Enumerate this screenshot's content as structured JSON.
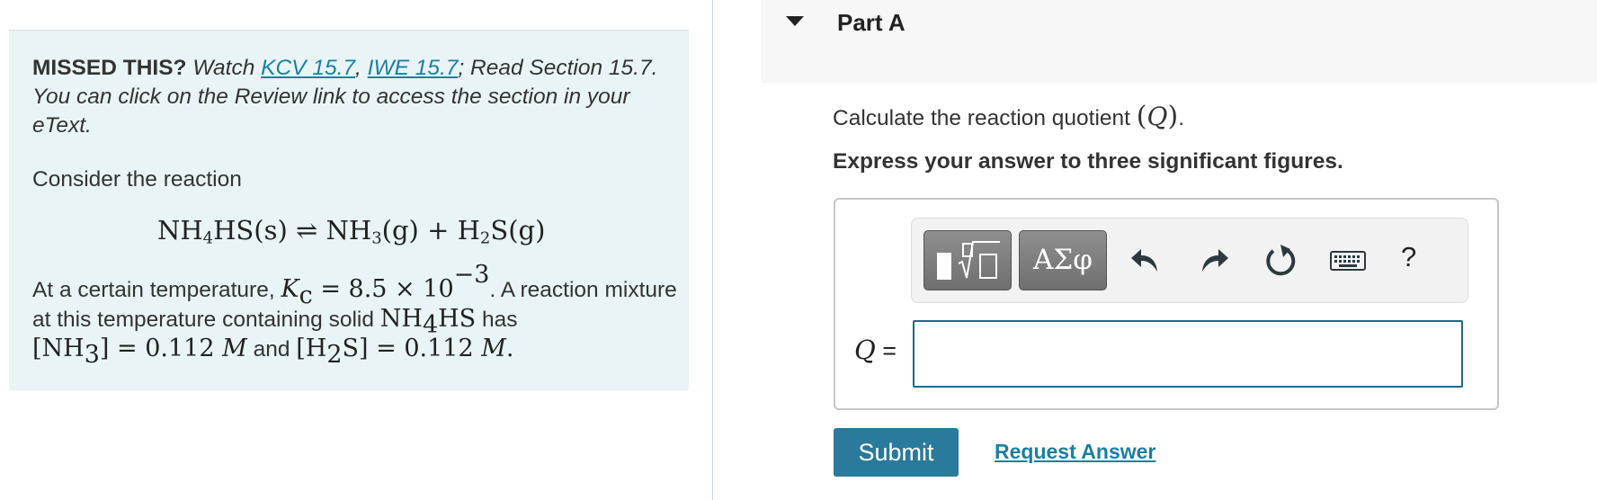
{
  "left_panel": {
    "missed_bold": "MISSED THIS?",
    "missed_watch": "Watch",
    "link_kcv": "KCV 15.7",
    "link_sep": ",",
    "link_iwe": "IWE 15.7",
    "missed_rest": "; Read Section 15.7. You can click on the Review link to access the section in your eText.",
    "consider": "Consider the reaction",
    "eq": {
      "r1_a": "NH",
      "r1_sub": "4",
      "r1_b": "HS(s)",
      "arrow": "⇌",
      "p1_a": "NH",
      "p1_sub": "3",
      "p1_b": "(g)",
      "plus": "+",
      "p2_a": "H",
      "p2_sub": "2",
      "p2_b": "S(g)"
    },
    "para": {
      "t1": "At a certain temperature, ",
      "kc": "K",
      "kc_sub": "c",
      "kc_val": " = 8.5 × 10",
      "kc_exp": "−3",
      "t2": ". A reaction mixture at this temperature containing solid ",
      "nh4hs_a": "NH",
      "nh4hs_sub": "4",
      "nh4hs_b": "HS",
      "t3": " has ",
      "c1_a": "[NH",
      "c1_sub": "3",
      "c1_b": "] = 0.112 ",
      "unit": "M",
      "t4": " and ",
      "c2_a": "[H",
      "c2_sub": "2",
      "c2_b": "S] = 0.112 ",
      "t5": "."
    }
  },
  "part": {
    "title": "Part A"
  },
  "question": {
    "prompt_text": "Calculate the reaction quotient ",
    "prompt_open": "(",
    "prompt_var": "Q",
    "prompt_close": ")",
    "prompt_end": ".",
    "instruction": "Express your answer to three significant figures."
  },
  "toolbar": {
    "greek_label": "ΑΣφ",
    "help_label": "?"
  },
  "answer": {
    "var": "Q",
    "eq": " =",
    "value": "",
    "placeholder": ""
  },
  "buttons": {
    "submit": "Submit",
    "request": "Request Answer"
  },
  "colors": {
    "info_bg": "#e8f4f6",
    "link": "#1a7fa3",
    "submit_bg": "#2a7a9b",
    "input_border": "#1a6a8c"
  },
  "icons": [
    "caret-down-icon",
    "templates-icon",
    "undo-icon",
    "redo-icon",
    "reset-icon",
    "keyboard-icon"
  ]
}
